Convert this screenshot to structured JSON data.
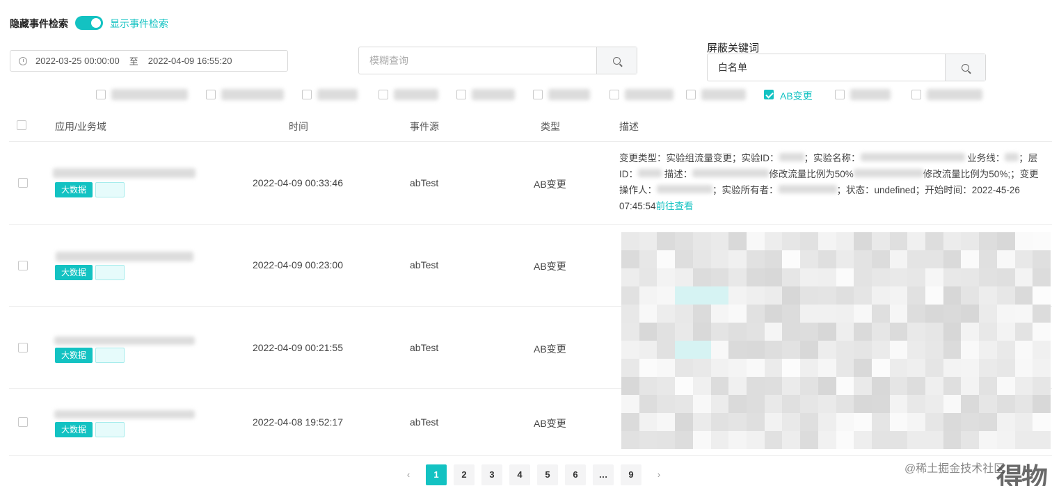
{
  "toggle": {
    "label": "隐藏事件检索",
    "link": "显示事件检索"
  },
  "date_range": {
    "start": "2022-03-25 00:00:00",
    "separator": "至",
    "end": "2022-04-09 16:55:20"
  },
  "fuzzy_search": {
    "placeholder": "模糊查询"
  },
  "block_keywords": {
    "label": "屏蔽关键词",
    "value": "白名单"
  },
  "filters": {
    "checked_label": "AB变更"
  },
  "table": {
    "headers": {
      "app": "应用/业务域",
      "time": "时间",
      "source": "事件源",
      "type": "类型",
      "desc": "描述"
    },
    "rows": [
      {
        "tag": "大数据",
        "time": "2022-04-09 00:33:46",
        "source": "abTest",
        "type": "AB变更"
      },
      {
        "tag": "大数据",
        "time": "2022-04-09 00:23:00",
        "source": "abTest",
        "type": "AB变更"
      },
      {
        "tag": "大数据",
        "time": "2022-04-09 00:21:55",
        "source": "abTest",
        "type": "AB变更"
      },
      {
        "tag": "大数据",
        "time": "2022-04-08 19:52:17",
        "source": "abTest",
        "type": "AB变更"
      }
    ],
    "first_desc": {
      "p1": "变更类型：实验组流量变更；实验ID：",
      "p2": "；实验名称：",
      "p3": "业务线：",
      "p4": "；层ID：",
      "p5": "描述：",
      "p6": "修改流量比例为50%",
      "p7": "修改流量比例为50%;；变更操作人：",
      "p8": "；实验所有者：",
      "p9": "；状态：undefined；开始时间：2022-45-26 07:45:54",
      "link": "前往查看"
    }
  },
  "pagination": {
    "pages": [
      "1",
      "2",
      "3",
      "4",
      "5",
      "6",
      "…",
      "9"
    ],
    "active": "1",
    "prev": "‹",
    "next": "›"
  },
  "watermark": {
    "text": "@稀土掘金技术社区",
    "corner": "得物"
  },
  "colors": {
    "accent": "#13c2c2"
  }
}
